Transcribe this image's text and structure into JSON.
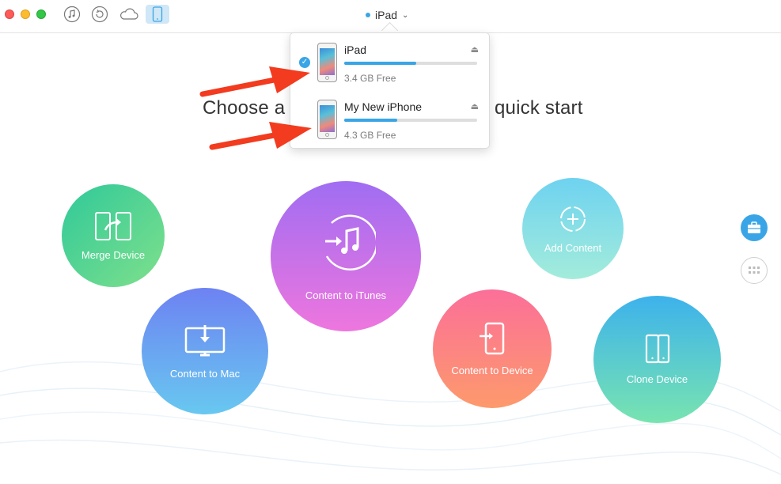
{
  "toolbar": {
    "buttons": [
      {
        "icon": "music-note-icon"
      },
      {
        "icon": "restore-icon"
      },
      {
        "icon": "cloud-icon"
      },
      {
        "icon": "phone-icon",
        "active": true
      }
    ],
    "device_selector": {
      "label": "iPad",
      "chevron": "⌄"
    }
  },
  "headline": {
    "left_text": "Choose a s",
    "right_text": "quick start"
  },
  "device_menu": {
    "devices": [
      {
        "name": "iPad",
        "free": "3.4 GB Free",
        "selected": true,
        "used_fraction": 0.54
      },
      {
        "name": "My New iPhone",
        "free": "4.3 GB Free",
        "selected": false,
        "used_fraction": 0.4
      }
    ],
    "eject_glyph": "⏏",
    "check_glyph": "✓"
  },
  "actions": {
    "merge": {
      "label": "Merge Device"
    },
    "itunes": {
      "label": "Content to iTunes"
    },
    "add": {
      "label": "Add Content"
    },
    "mac": {
      "label": "Content to Mac"
    },
    "device": {
      "label": "Content to Device"
    },
    "clone": {
      "label": "Clone Device"
    }
  },
  "colors": {
    "accent": "#3aa5e6",
    "arrow": "#f23b1f"
  }
}
